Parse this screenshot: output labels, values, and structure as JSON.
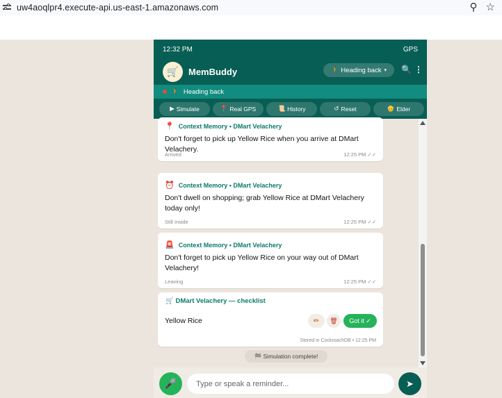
{
  "browser": {
    "url": "uw4aoqlpr4.execute-api.us-east-1.amazonaws.com",
    "location_icon": "⚲",
    "star_icon": "☆"
  },
  "status": {
    "time": "12:32 PM",
    "mode": "GPS"
  },
  "header": {
    "avatar_icon": "🛒",
    "app_name": "MemBuddy",
    "dropdown_label": "🚶 Heading back",
    "dropdown_caret": "▾",
    "search_icon": "🔍",
    "menu_icon": "⋮"
  },
  "subbar": {
    "icon": "🚶",
    "label": "Heading back"
  },
  "buttons": [
    {
      "icon": "▶",
      "label": "Simulate"
    },
    {
      "icon": "📍",
      "label": "Real GPS"
    },
    {
      "icon": "📜",
      "label": "History"
    },
    {
      "icon": "↺",
      "label": "Reset"
    },
    {
      "icon": "👴",
      "label": "Elder"
    }
  ],
  "messages": [
    {
      "icon": "📍",
      "context": "Context Memory • DMart Velachery",
      "text": "Don't forget to pick up Yellow Rice when you arrive at DMart Velachery.",
      "state": "Arrived",
      "time": "12:25 PM ✓✓"
    },
    {
      "icon": "⏰",
      "context": "Context Memory • DMart Velachery",
      "text": "Don't dwell on shopping; grab Yellow Rice at DMart Velachery today only!",
      "state": "Still inside",
      "time": "12:25 PM ✓✓"
    },
    {
      "icon": "🚨",
      "context": "Context Memory • DMart Velachery",
      "text": "Don't forget to pick up Yellow Rice on your way out of DMart Velachery!",
      "state": "Leaving",
      "time": "12:25 PM ✓✓"
    }
  ],
  "checklist": {
    "title": "🛒 DMart Velachery — checklist",
    "item": "Yellow Rice",
    "edit_icon": "✏",
    "delete_icon": "🗑",
    "got_it_label": "Got it ✓",
    "stored": "Stored in CockroachDB • 12:25 PM"
  },
  "simulation_complete": "🏁 Simulation complete!",
  "input": {
    "mic_icon": "🎤",
    "placeholder": "Type or speak a reminder...",
    "send_icon": "➤"
  }
}
